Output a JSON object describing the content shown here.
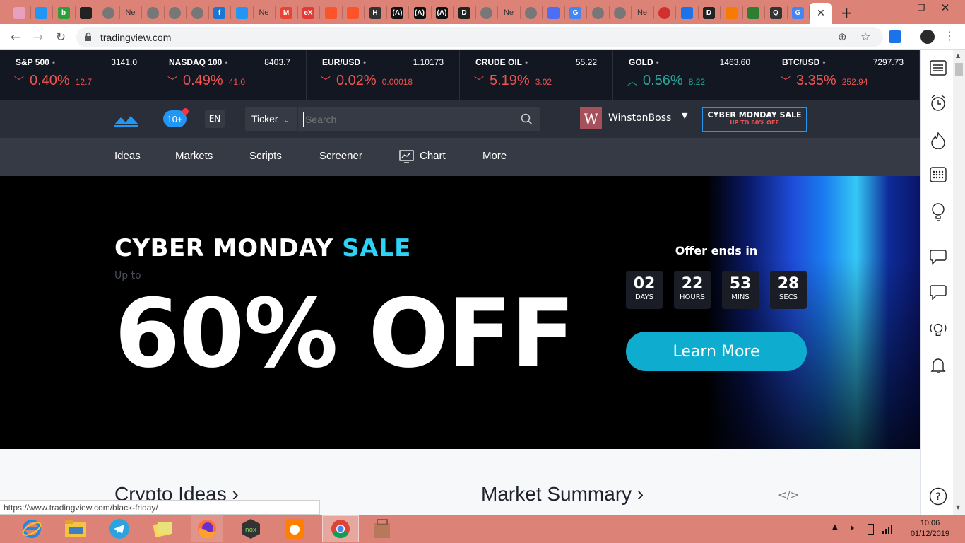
{
  "browser": {
    "tabs": [
      {
        "icon": "rainbow-icon",
        "label": ""
      },
      {
        "icon": "tradingview-icon",
        "label": ""
      },
      {
        "icon": "b-green-icon",
        "label": "b"
      },
      {
        "icon": "github-icon",
        "label": ""
      },
      {
        "icon": "globe-icon",
        "label": ""
      },
      {
        "icon": "text-tab",
        "label": "Ne"
      },
      {
        "icon": "globe-icon",
        "label": ""
      },
      {
        "icon": "globe-icon",
        "label": ""
      },
      {
        "icon": "globe-icon",
        "label": ""
      },
      {
        "icon": "f-blue-icon",
        "label": "f"
      },
      {
        "icon": "tradingview-icon",
        "label": ""
      },
      {
        "icon": "text-tab",
        "label": "Ne"
      },
      {
        "icon": "gmail-icon",
        "label": "M"
      },
      {
        "icon": "ebx-icon",
        "label": "eX"
      },
      {
        "icon": "brave-icon",
        "label": ""
      },
      {
        "icon": "brave-icon",
        "label": ""
      },
      {
        "icon": "h-icon",
        "label": "H"
      },
      {
        "icon": "bracket-icon",
        "label": "(A)"
      },
      {
        "icon": "bracket-icon",
        "label": "(A)"
      },
      {
        "icon": "bracket-icon",
        "label": "(A)"
      },
      {
        "icon": "d-icon",
        "label": "D"
      },
      {
        "icon": "globe-icon",
        "label": ""
      },
      {
        "icon": "text-tab",
        "label": "Ne"
      },
      {
        "icon": "globe-icon",
        "label": ""
      },
      {
        "icon": "link-icon",
        "label": ""
      },
      {
        "icon": "google-icon",
        "label": "G"
      },
      {
        "icon": "globe-icon",
        "label": ""
      },
      {
        "icon": "globe-icon",
        "label": ""
      },
      {
        "icon": "text-tab",
        "label": "Ne"
      },
      {
        "icon": "red-circle-icon",
        "label": ""
      },
      {
        "icon": "download-icon",
        "label": ""
      },
      {
        "icon": "d-icon",
        "label": "D"
      },
      {
        "icon": "flame-icon",
        "label": ""
      },
      {
        "icon": "owl-icon",
        "label": ""
      },
      {
        "icon": "q-icon",
        "label": "Q"
      },
      {
        "icon": "google-icon",
        "label": "G"
      }
    ],
    "active_tab_close": "✕",
    "new_tab": "+",
    "url": "tradingview.com",
    "status_url": "https://www.tradingview.com/black-friday/"
  },
  "tickers": [
    {
      "name": "S&P 500",
      "value": "3141.0",
      "change_pct": "0.40%",
      "change_abs": "12.7",
      "direction": "down"
    },
    {
      "name": "NASDAQ 100",
      "value": "8403.7",
      "change_pct": "0.49%",
      "change_abs": "41.0",
      "direction": "down"
    },
    {
      "name": "EUR/USD",
      "value": "1.10173",
      "change_pct": "0.02%",
      "change_abs": "0.00018",
      "direction": "down"
    },
    {
      "name": "CRUDE OIL",
      "value": "55.22",
      "change_pct": "5.19%",
      "change_abs": "3.02",
      "direction": "down"
    },
    {
      "name": "GOLD",
      "value": "1463.60",
      "change_pct": "0.56%",
      "change_abs": "8.22",
      "direction": "up"
    },
    {
      "name": "BTC/USD",
      "value": "7297.73",
      "change_pct": "3.35%",
      "change_abs": "252.94",
      "direction": "down"
    }
  ],
  "header": {
    "notifications": "10+",
    "lang": "EN",
    "search_scope": "Ticker",
    "search_placeholder": "Search",
    "user_initial": "W",
    "username": "WinstonBoss",
    "promo_title": "CYBER MONDAY SALE",
    "promo_sub": "UP TO 60% OFF"
  },
  "nav": [
    "Ideas",
    "Markets",
    "Scripts",
    "Screener",
    "Chart",
    "More"
  ],
  "hero": {
    "title_main": "CYBER MONDAY ",
    "title_accent": "SALE",
    "up_to": "Up to",
    "discount": "60% OFF",
    "offer_ends": "Offer ends in",
    "countdown": [
      {
        "num": "02",
        "label": "DAYS"
      },
      {
        "num": "22",
        "label": "HOURS"
      },
      {
        "num": "53",
        "label": "MINS"
      },
      {
        "num": "28",
        "label": "SECS"
      }
    ],
    "cta": "Learn More"
  },
  "lower": {
    "left_heading": "Crypto Ideas ›",
    "right_heading": "Market Summary ›",
    "embed_icon": "</>"
  },
  "taskbar": {
    "time": "10:06",
    "date": "01/12/2019"
  },
  "colors": {
    "accent": "#2dd3f6",
    "down": "#ef5350",
    "up": "#26a69a",
    "chrome_frame": "#dc8276"
  }
}
